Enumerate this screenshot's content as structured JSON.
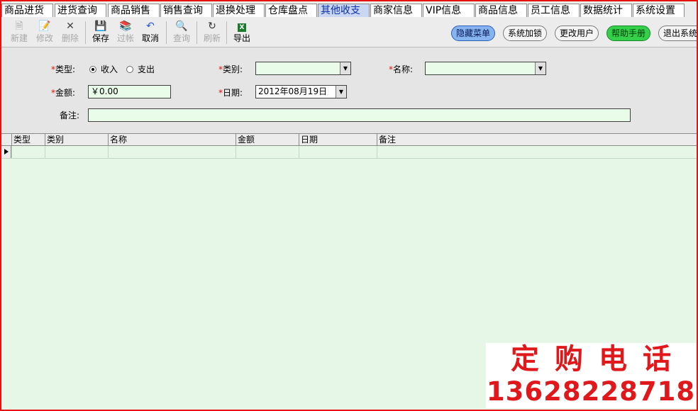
{
  "tabs": [
    {
      "label": "商品进货",
      "active": false
    },
    {
      "label": "进货查询",
      "active": false
    },
    {
      "label": "商品销售",
      "active": false
    },
    {
      "label": "销售查询",
      "active": false
    },
    {
      "label": "退换处理",
      "active": false
    },
    {
      "label": "仓库盘点",
      "active": false
    },
    {
      "label": "其他收支",
      "active": true
    },
    {
      "label": "商家信息",
      "active": false
    },
    {
      "label": "VIP信息",
      "active": false
    },
    {
      "label": "商品信息",
      "active": false
    },
    {
      "label": "员工信息",
      "active": false
    },
    {
      "label": "数据统计",
      "active": false
    },
    {
      "label": "系统设置",
      "active": false
    }
  ],
  "toolbar": {
    "new": "新建",
    "edit": "修改",
    "delete": "删除",
    "save": "保存",
    "post": "过帐",
    "cancel": "取消",
    "query": "查询",
    "refresh": "刷新",
    "export": "导出"
  },
  "actions": {
    "hide_menu": "隐藏菜单",
    "lock": "系统加锁",
    "change_user": "更改用户",
    "help": "帮助手册",
    "exit": "退出系统"
  },
  "form": {
    "type_label": "类型:",
    "income": "收入",
    "expense": "支出",
    "type_value": "收入",
    "category_label": "类别:",
    "category_value": "",
    "name_label": "名称:",
    "name_value": "",
    "amount_label": "金额:",
    "amount_value": "￥0.00",
    "date_label": "日期:",
    "date_value": "2012年08月19日",
    "remark_label": "备注:",
    "remark_value": ""
  },
  "grid": {
    "columns": [
      "类型",
      "类别",
      "名称",
      "金额",
      "日期",
      "备注"
    ],
    "rows": [
      [
        "",
        "",
        "",
        "",
        "",
        ""
      ]
    ]
  },
  "promo": {
    "title": "定购电话",
    "phone": "13628228718"
  },
  "colors": {
    "frame_red": "#e81010",
    "grid_bg": "#e6f7e8",
    "active_tab": "#c9d7f5",
    "hide_menu_blue": "#87b4ef",
    "help_green": "#34d04a",
    "promo_red": "#e0171b"
  }
}
